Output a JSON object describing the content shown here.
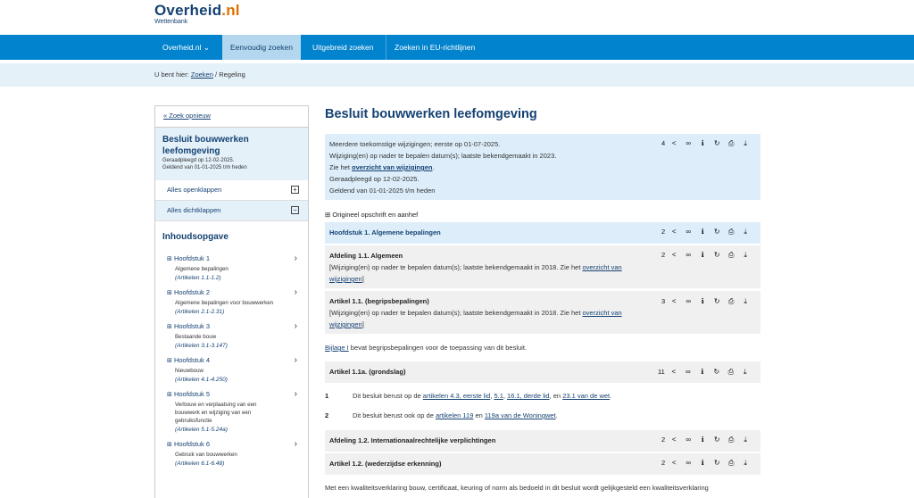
{
  "header": {
    "logo_main": "Overheid",
    "logo_dot": ".nl",
    "logo_sub": "Wettenbank"
  },
  "nav": [
    {
      "label": "Overheid.nl ⌄"
    },
    {
      "label": "Eenvoudig zoeken"
    },
    {
      "label": "Uitgebreid zoeken"
    },
    {
      "label": "Zoeken in EU-richtlijnen"
    }
  ],
  "breadcrumb": {
    "prefix": "U bent hier:",
    "link": "Zoeken",
    "sep": "/",
    "current": "Regeling"
  },
  "sidebar": {
    "back": "« Zoek opnieuw",
    "title": "Besluit bouwwerken leefomgeving",
    "meta1": "Geraadpleegd op 12-02-2025.",
    "meta2": "Geldend van 01-01-2025 t/m heden",
    "expand_all": "Alles openklappen",
    "collapse_all": "Alles dichtklappen",
    "toc_title": "Inhoudsopgave",
    "toc": [
      {
        "head": "Hoofdstuk 1",
        "desc": "Algemene bepalingen",
        "art": "(Artikelen 1.1-1.2)"
      },
      {
        "head": "Hoofdstuk 2",
        "desc": "Algemene bepalingen voor bouwwerken",
        "art": "(Artikelen 2.1-2.31)"
      },
      {
        "head": "Hoofdstuk 3",
        "desc": "Bestaande bouw",
        "art": "(Artikelen 3.1-3.147)"
      },
      {
        "head": "Hoofdstuk 4",
        "desc": "Nieuwbouw",
        "art": "(Artikelen 4.1-4.250)"
      },
      {
        "head": "Hoofdstuk 5",
        "desc": "Verbouw en verplaatsing van een bouwwerk en wijziging van een gebruiksfunctie",
        "art": "(Artikelen 5.1-5.24a)"
      },
      {
        "head": "Hoofdstuk 6",
        "desc": "Gebruik van bouwwerken",
        "art": "(Artikelen 6.1-6.48)"
      }
    ]
  },
  "main": {
    "title": "Besluit bouwwerken leefomgeving",
    "notice": {
      "line1": "Meerdere toekomstige wijzigingen; eerste op 01-07-2025.",
      "line2": "Wijziging(en) op nader te bepalen datum(s); laatste bekendgemaakt in 2023.",
      "line3_pre": "Zie het",
      "line3_link": "overzicht van wijzigingen",
      "line3_post": ".",
      "line4": "Geraadpleegd op 12-02-2025.",
      "line5": "Geldend van 01-01-2025 t/m heden",
      "count": "4"
    },
    "orig": "⊞ Origineel opschrift en aanhef",
    "h1": {
      "title": "Hoofdstuk 1. Algemene bepalingen",
      "count": "2"
    },
    "afd11": {
      "title": "Afdeling 1.1. Algemeen",
      "text": "[Wijziging(en) op nader te bepalen datum(s); laatste bekendgemaakt in 2018. Zie het",
      "link1": "overzicht van",
      "link2": "wijzigingen",
      "text_end": "]",
      "count": "2"
    },
    "art11": {
      "title": "Artikel 1.1. (begripsbepalingen)",
      "text": "[Wijziging(en) op nader te bepalen datum(s); laatste bekendgemaakt in 2018. Zie het",
      "link1": "overzicht van",
      "link2": "wijzigingen",
      "text_end": "]",
      "count": "3"
    },
    "bijlage": {
      "link": "Bijlage I",
      "text": " bevat begripsbepalingen voor de toepassing van dit besluit."
    },
    "art11a": {
      "title": "Artikel 1.1a. (grondslag)",
      "count": "11"
    },
    "lid1": {
      "num": "1",
      "pre": "Dit besluit berust op de ",
      "l1": "artikelen 4.3, eerste lid",
      "s1": ", ",
      "l2": "5.1",
      "s2": ", ",
      "l3": "16.1, derde lid",
      "s3": ", en ",
      "l4": "23.1 van de wet",
      "end": "."
    },
    "lid2": {
      "num": "2",
      "pre": "Dit besluit berust ook op de ",
      "l1": "artikelen 119",
      "s1": " en ",
      "l2": "119a van de Woningwet",
      "end": "."
    },
    "afd12": {
      "title": "Afdeling 1.2. Internationaalrechtelijke verplichtingen",
      "count": "2"
    },
    "art12": {
      "title": "Artikel 1.2. (wederzijdse erkenning)",
      "count": "2"
    },
    "bottom_text": "Met een kwaliteitsverklaring bouw, certificaat, keuring of norm als bedoeld in dit besluit wordt gelijkgesteld een kwaliteitsverklaring"
  },
  "icons": [
    "share-icon",
    "link-icon",
    "info-icon",
    "history-icon",
    "print-icon",
    "download-icon"
  ]
}
